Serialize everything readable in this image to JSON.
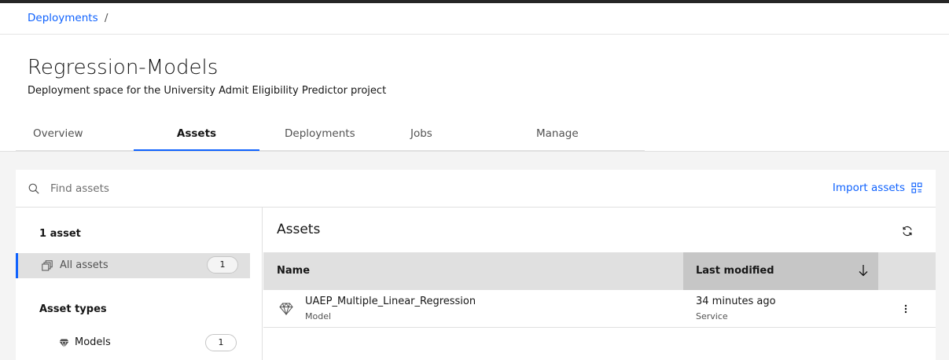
{
  "breadcrumb": {
    "root": "Deployments",
    "separator": "/"
  },
  "header": {
    "title": "Regression-Models",
    "subtitle": "Deployment space for the University Admit Eligibility Predictor project"
  },
  "tabs": [
    {
      "label": "Overview",
      "active": false
    },
    {
      "label": "Assets",
      "active": true
    },
    {
      "label": "Deployments",
      "active": false
    },
    {
      "label": "Jobs",
      "active": false
    },
    {
      "label": "Manage",
      "active": false
    }
  ],
  "search": {
    "placeholder": "Find assets",
    "icon": "search-icon"
  },
  "import_assets": {
    "label": "Import assets",
    "icon": "import-icon"
  },
  "sidebar": {
    "asset_count": "1 asset",
    "all_assets": {
      "label": "All assets",
      "count": "1",
      "icon": "stack-icon"
    },
    "asset_types_heading": "Asset types",
    "types": [
      {
        "label": "Models",
        "count": "1",
        "icon": "model-diamond-icon"
      }
    ]
  },
  "assets_panel": {
    "title": "Assets",
    "refresh_icon": "refresh-icon",
    "columns": {
      "name": "Name",
      "last_modified": "Last modified",
      "sort": "descending"
    },
    "rows": [
      {
        "name": "UAEP_Multiple_Linear_Regression",
        "type": "Model",
        "modified": "34 minutes ago",
        "source": "Service",
        "icon": "model-diamond-icon",
        "menu_icon": "overflow-menu-icon"
      }
    ]
  },
  "colors": {
    "accent": "#0f62fe",
    "background": "#f4f4f4",
    "header_dark": "#262626",
    "table_header": "#e0e0e0",
    "sorted_column": "#c6c6c6"
  }
}
